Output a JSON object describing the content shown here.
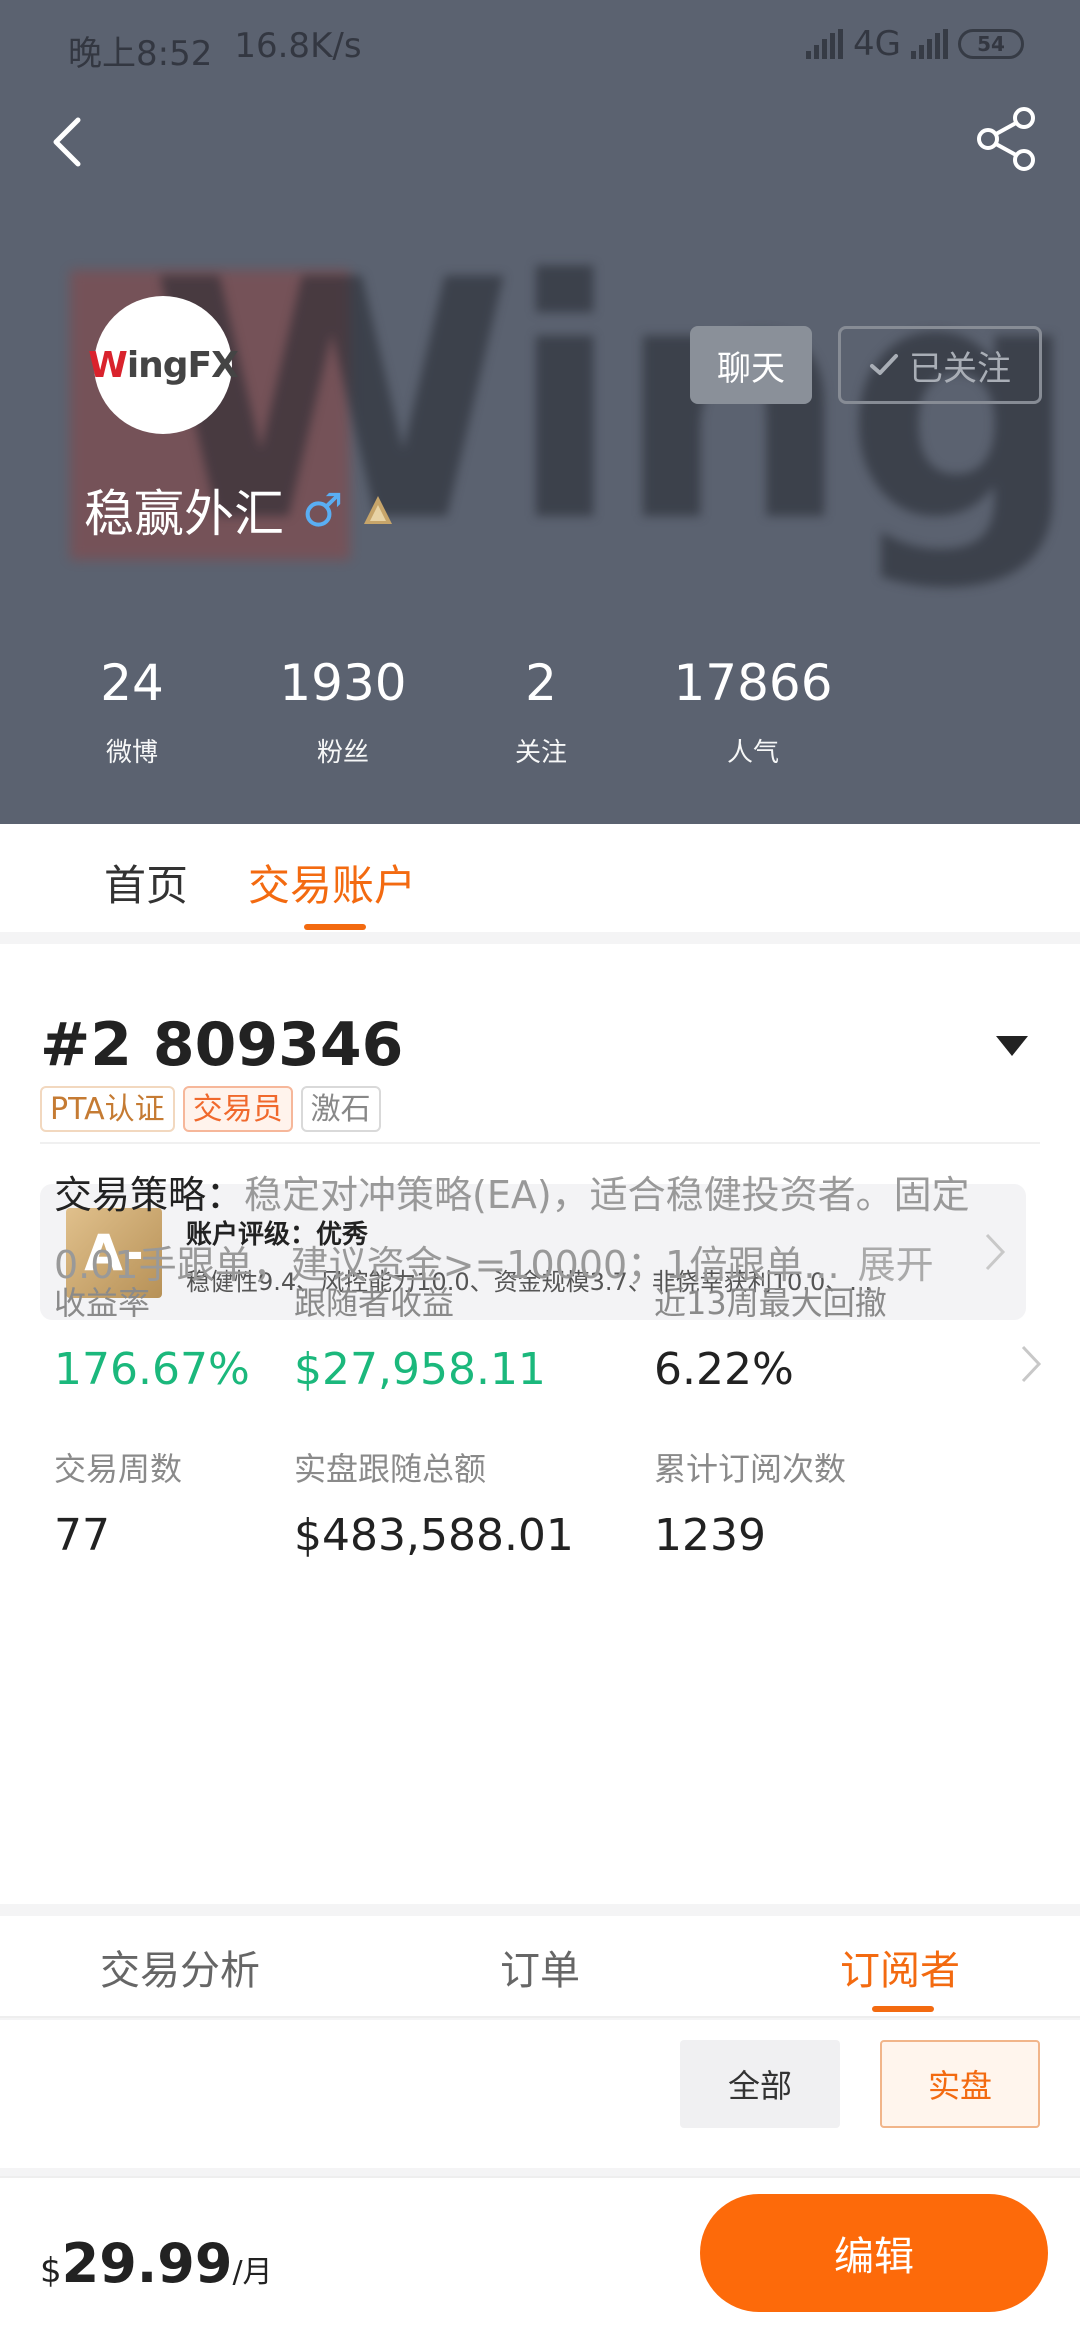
{
  "status_bar": {
    "time": "晚上8:52",
    "speed": "16.8K/s",
    "network": "4G",
    "battery": "54"
  },
  "profile": {
    "avatar_text_a": "W",
    "avatar_text_b": "ingFX",
    "background_text": "WingFX",
    "name": "稳赢外汇",
    "gender": "♂",
    "chat_label": "聊天",
    "follow_label": "已关注"
  },
  "stats": [
    {
      "value": "24",
      "label": "微博"
    },
    {
      "value": "1930",
      "label": "粉丝"
    },
    {
      "value": "2",
      "label": "关注"
    },
    {
      "value": "17866",
      "label": "人气"
    }
  ],
  "tabs": {
    "home": "首页",
    "account": "交易账户"
  },
  "account": {
    "id": "#2 809346",
    "badges": [
      "PTA认证",
      "交易员",
      "激石"
    ],
    "rating": {
      "grade": "A-",
      "title": "账户评级：优秀",
      "desc": "稳健性9.4、风控能力10.0、资金规模3.7、非侥幸获利10.0、..."
    },
    "metrics": [
      {
        "label": "收益率",
        "value": "176.67%"
      },
      {
        "label": "跟随者收益",
        "value": "$27,958.11"
      },
      {
        "label": "近13周最大回撤",
        "value": "6.22%"
      },
      {
        "label": "交易周数",
        "value": "77"
      },
      {
        "label": "实盘跟随总额",
        "value": "$483,588.01"
      },
      {
        "label": "累计订阅次数",
        "value": "1239"
      }
    ],
    "strategy": {
      "key": "交易策略：",
      "text": "稳定对冲策略(EA)，适合稳健投资者。固定0.01手跟单，建议资金>=10000；1倍跟单...",
      "more": "展开"
    }
  },
  "subtabs": [
    "交易分析",
    "订单",
    "订阅者"
  ],
  "filters": {
    "all": "全部",
    "real": "实盘"
  },
  "footer": {
    "currency": "$",
    "price": "29.99",
    "period": "/月",
    "edit_label": "编辑"
  },
  "colors": {
    "accent": "#f36a10",
    "green": "#1bb87c",
    "header_bg": "#5b6270"
  }
}
